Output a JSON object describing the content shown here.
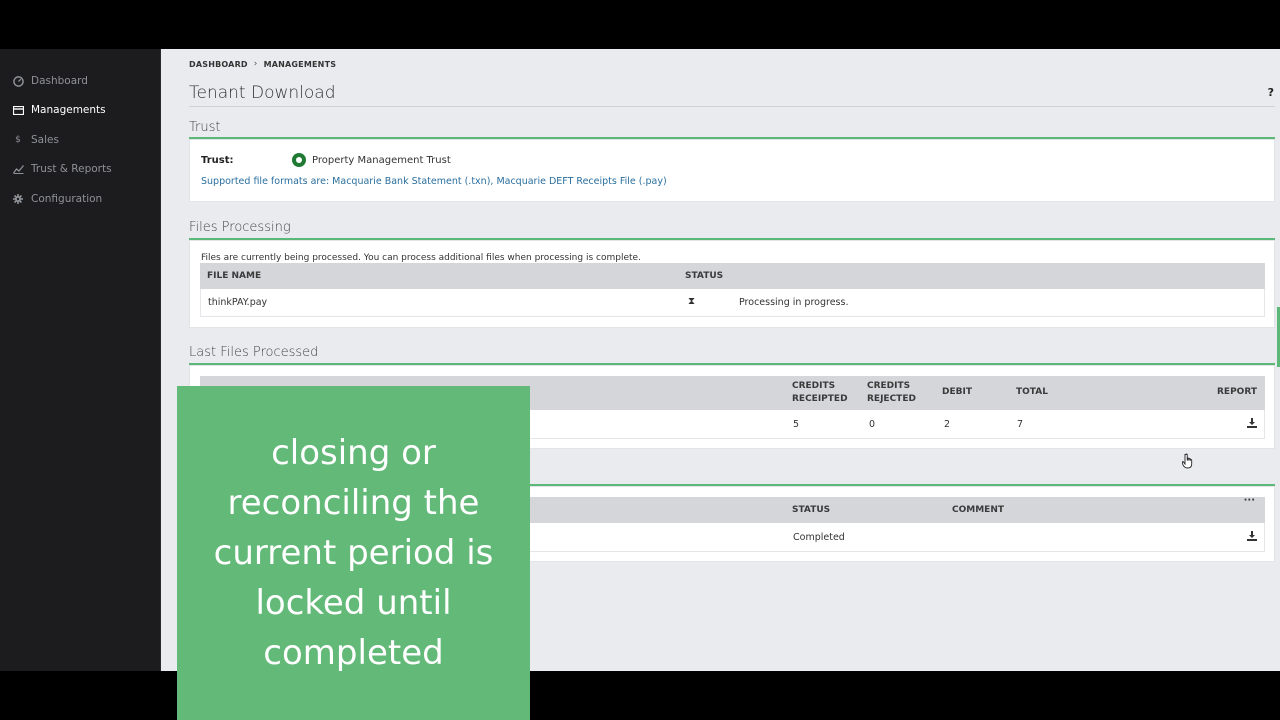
{
  "sidebar": {
    "items": [
      {
        "label": "Dashboard",
        "icon": "dashboard-icon"
      },
      {
        "label": "Managements",
        "icon": "card-icon"
      },
      {
        "label": "Sales",
        "icon": "dollar-icon"
      },
      {
        "label": "Trust & Reports",
        "icon": "chart-line-icon"
      },
      {
        "label": "Configuration",
        "icon": "gear-icon"
      }
    ],
    "active": "Managements"
  },
  "breadcrumb": {
    "items": [
      "DASHBOARD",
      "MANAGEMENTS"
    ]
  },
  "page": {
    "title": "Tenant Download",
    "help": "?"
  },
  "trust": {
    "section_title": "Trust",
    "label": "Trust:",
    "option": "Property Management Trust",
    "formats": "Supported file formats are: Macquarie Bank Statement (.txn), Macquarie DEFT Receipts File (.pay)"
  },
  "processing": {
    "section_title": "Files Processing",
    "note": "Files are currently being processed. You can process additional files when processing is complete.",
    "headers": [
      "FILE NAME",
      "STATUS"
    ],
    "rows": [
      {
        "file": "thinkPAY.pay",
        "status": "Processing in progress."
      }
    ]
  },
  "last_files": {
    "section_title": "Last Files Processed",
    "headers": {
      "credits_receipted": "CREDITS RECEIPTED",
      "credits_rejected": "CREDITS REJECTED",
      "debit": "DEBIT",
      "total": "TOTAL",
      "report": "REPORT"
    },
    "rows": [
      {
        "credits_receipted": "5",
        "credits_rejected": "0",
        "debit": "2",
        "total": "7"
      }
    ]
  },
  "history": {
    "headers": {
      "status": "STATUS",
      "comment": "COMMENT"
    },
    "more": "···",
    "rows": [
      {
        "status": "Completed",
        "comment": ""
      }
    ]
  },
  "overlay": {
    "text": "closing or reconciling the current period is locked until completed"
  },
  "colors": {
    "accent": "#5cb878",
    "sidebar_bg": "#1c1c1e",
    "overlay_bg": "#62b978"
  }
}
